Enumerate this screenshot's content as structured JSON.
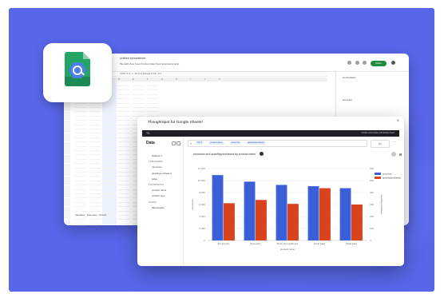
{
  "colors": {
    "background": "#5867ea",
    "series_a": "#3b5fd9",
    "series_b": "#d9431e",
    "sheets_green": "#23a566",
    "share_green": "#1e8e3e"
  },
  "logo": {
    "icon": "google-sheets-thoughtspot-logo-icon"
  },
  "sheet": {
    "doc_title": "Untitled spreadsheet",
    "menu": "File  Edit  View  Insert  Format  Data  Tools  Extensions  Help",
    "toolbar": "100%   $  %  .0  .00  123   Default   10   B  I  S  A",
    "columns": [
      "A",
      "B",
      "C",
      "D",
      "E",
      "F",
      "G",
      "H",
      "I",
      "J",
      "K"
    ],
    "share_label": "Share",
    "side_items": [
      "Connections",
      "Get data",
      "Filters",
      "Refresh"
    ],
    "tabs": [
      "Variables",
      "Summary",
      "Sheet1"
    ]
  },
  "ts": {
    "window_title": "ThoughtSpot for Google Sheets*",
    "close": "×",
    "brand": "TS",
    "nav": "HOME  DATA  ANALYZE  MORE  HELP",
    "data_heading": "Data",
    "left": {
      "items": [
        {
          "label": "Dataset 1",
          "group": false
        },
        {
          "label": "MEASURES",
          "group": true
        },
        {
          "label": "tomorrow",
          "group": false
        },
        {
          "label": "quantitypurchased",
          "group": false
        },
        {
          "label": "sales",
          "group": false
        },
        {
          "label": "ATTRIBUTES",
          "group": true
        },
        {
          "label": "product name",
          "group": false
        },
        {
          "label": "product type",
          "group": false
        },
        {
          "label": "DATE",
          "group": true
        },
        {
          "label": "date/weekly",
          "group": false
        }
      ]
    },
    "search_chips": [
      "Top 5",
      "product name",
      "tomorrow",
      "quantitypurchased"
    ],
    "go_label": "Go",
    "chart_title": "tomorrow and quantitypurchased by product name"
  },
  "chart_data": {
    "type": "bar",
    "title": "tomorrow and quantitypurchased by product name",
    "xlabel": "product name",
    "ylabel": "tomorrow",
    "y2label": "quantitypurchased",
    "categories": [
      "Pro tint plus",
      "Eyes paint",
      "Shell color (quick set)",
      "Fresh paint",
      "Metal paint"
    ],
    "series": [
      {
        "name": "tomorrow",
        "values": [
          100,
          90,
          85,
          83,
          80
        ],
        "axis": "left"
      },
      {
        "name": "quantitypurchased",
        "values": [
          57,
          62,
          56,
          80,
          55
        ],
        "axis": "right"
      }
    ],
    "ylim": [
      0,
      110
    ],
    "y_ticks": [
      "0",
      "2,000",
      "4,000",
      "6,000",
      "8,000",
      "10,000",
      "12,000"
    ],
    "y2_ticks": [
      "0",
      "100",
      "200",
      "300",
      "400",
      "500",
      "600"
    ],
    "legend": "right",
    "grid": true
  }
}
